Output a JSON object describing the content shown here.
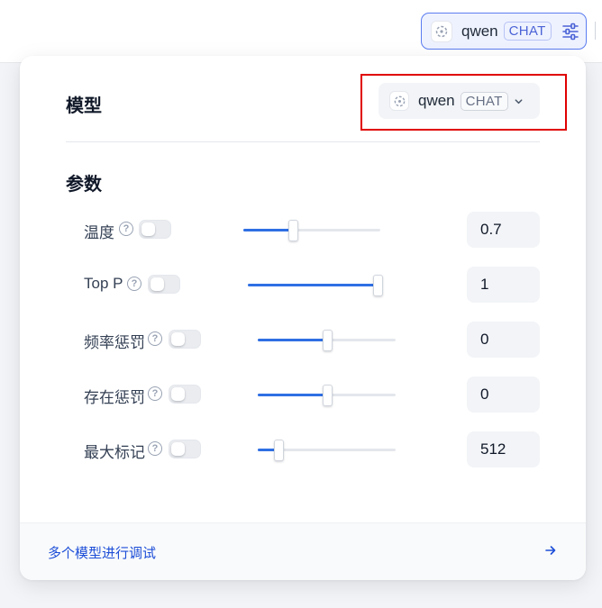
{
  "header": {
    "model_name": "qwen",
    "model_tag": "CHAT",
    "settings_icon": "sliders-icon"
  },
  "panel": {
    "model_section_title": "模型",
    "selected_model": {
      "name": "qwen",
      "tag": "CHAT",
      "icon": "model-icon",
      "dropdown_icon": "chevron-down-icon"
    },
    "params_section_title": "参数",
    "params": [
      {
        "label": "温度",
        "enabled": false,
        "value": "0.7",
        "fraction": 0.36
      },
      {
        "label": "Top P",
        "enabled": false,
        "value": "1",
        "fraction": 1.0
      },
      {
        "label": "频率惩罚",
        "enabled": false,
        "value": "0",
        "fraction": 0.5
      },
      {
        "label": "存在惩罚",
        "enabled": false,
        "value": "0",
        "fraction": 0.5
      },
      {
        "label": "最大标记",
        "enabled": false,
        "value": "512",
        "fraction": 0.15
      }
    ],
    "footer_link": "多个模型进行调试",
    "footer_icon": "arrow-right-icon"
  },
  "colors": {
    "accent": "#2f6fe4",
    "link": "#1d4ed8",
    "highlight": "#e00000"
  }
}
